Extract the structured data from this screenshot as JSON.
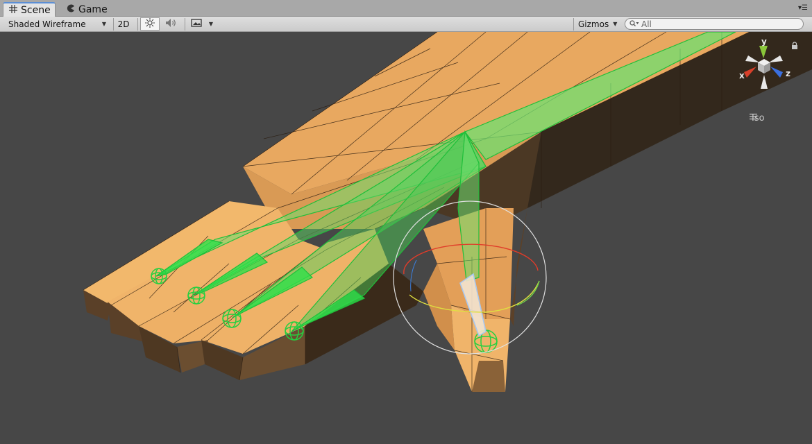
{
  "tabs": [
    {
      "label": "Scene",
      "icon": "grid-icon",
      "active": true
    },
    {
      "label": "Game",
      "icon": "pacman-icon",
      "active": false
    }
  ],
  "toolbar": {
    "draw_mode": "Shaded Wireframe",
    "toggle_2d": "2D",
    "lighting_icon": "sun-icon",
    "audio_icon": "speaker-icon",
    "effects_icon": "image-icon",
    "gizmos_label": "Gizmos",
    "search_placeholder": "All"
  },
  "gizmo": {
    "axes": [
      "y",
      "x",
      "z"
    ],
    "projection": "Iso",
    "colors": {
      "x": "#d8402a",
      "y": "#8ac63a",
      "z": "#3a6fe0"
    }
  },
  "viewport": {
    "background": "#474747",
    "mesh_color": "#f2b86c",
    "bone_color": "#2ee04a",
    "selected_bone_color": "#cfe0f0"
  }
}
